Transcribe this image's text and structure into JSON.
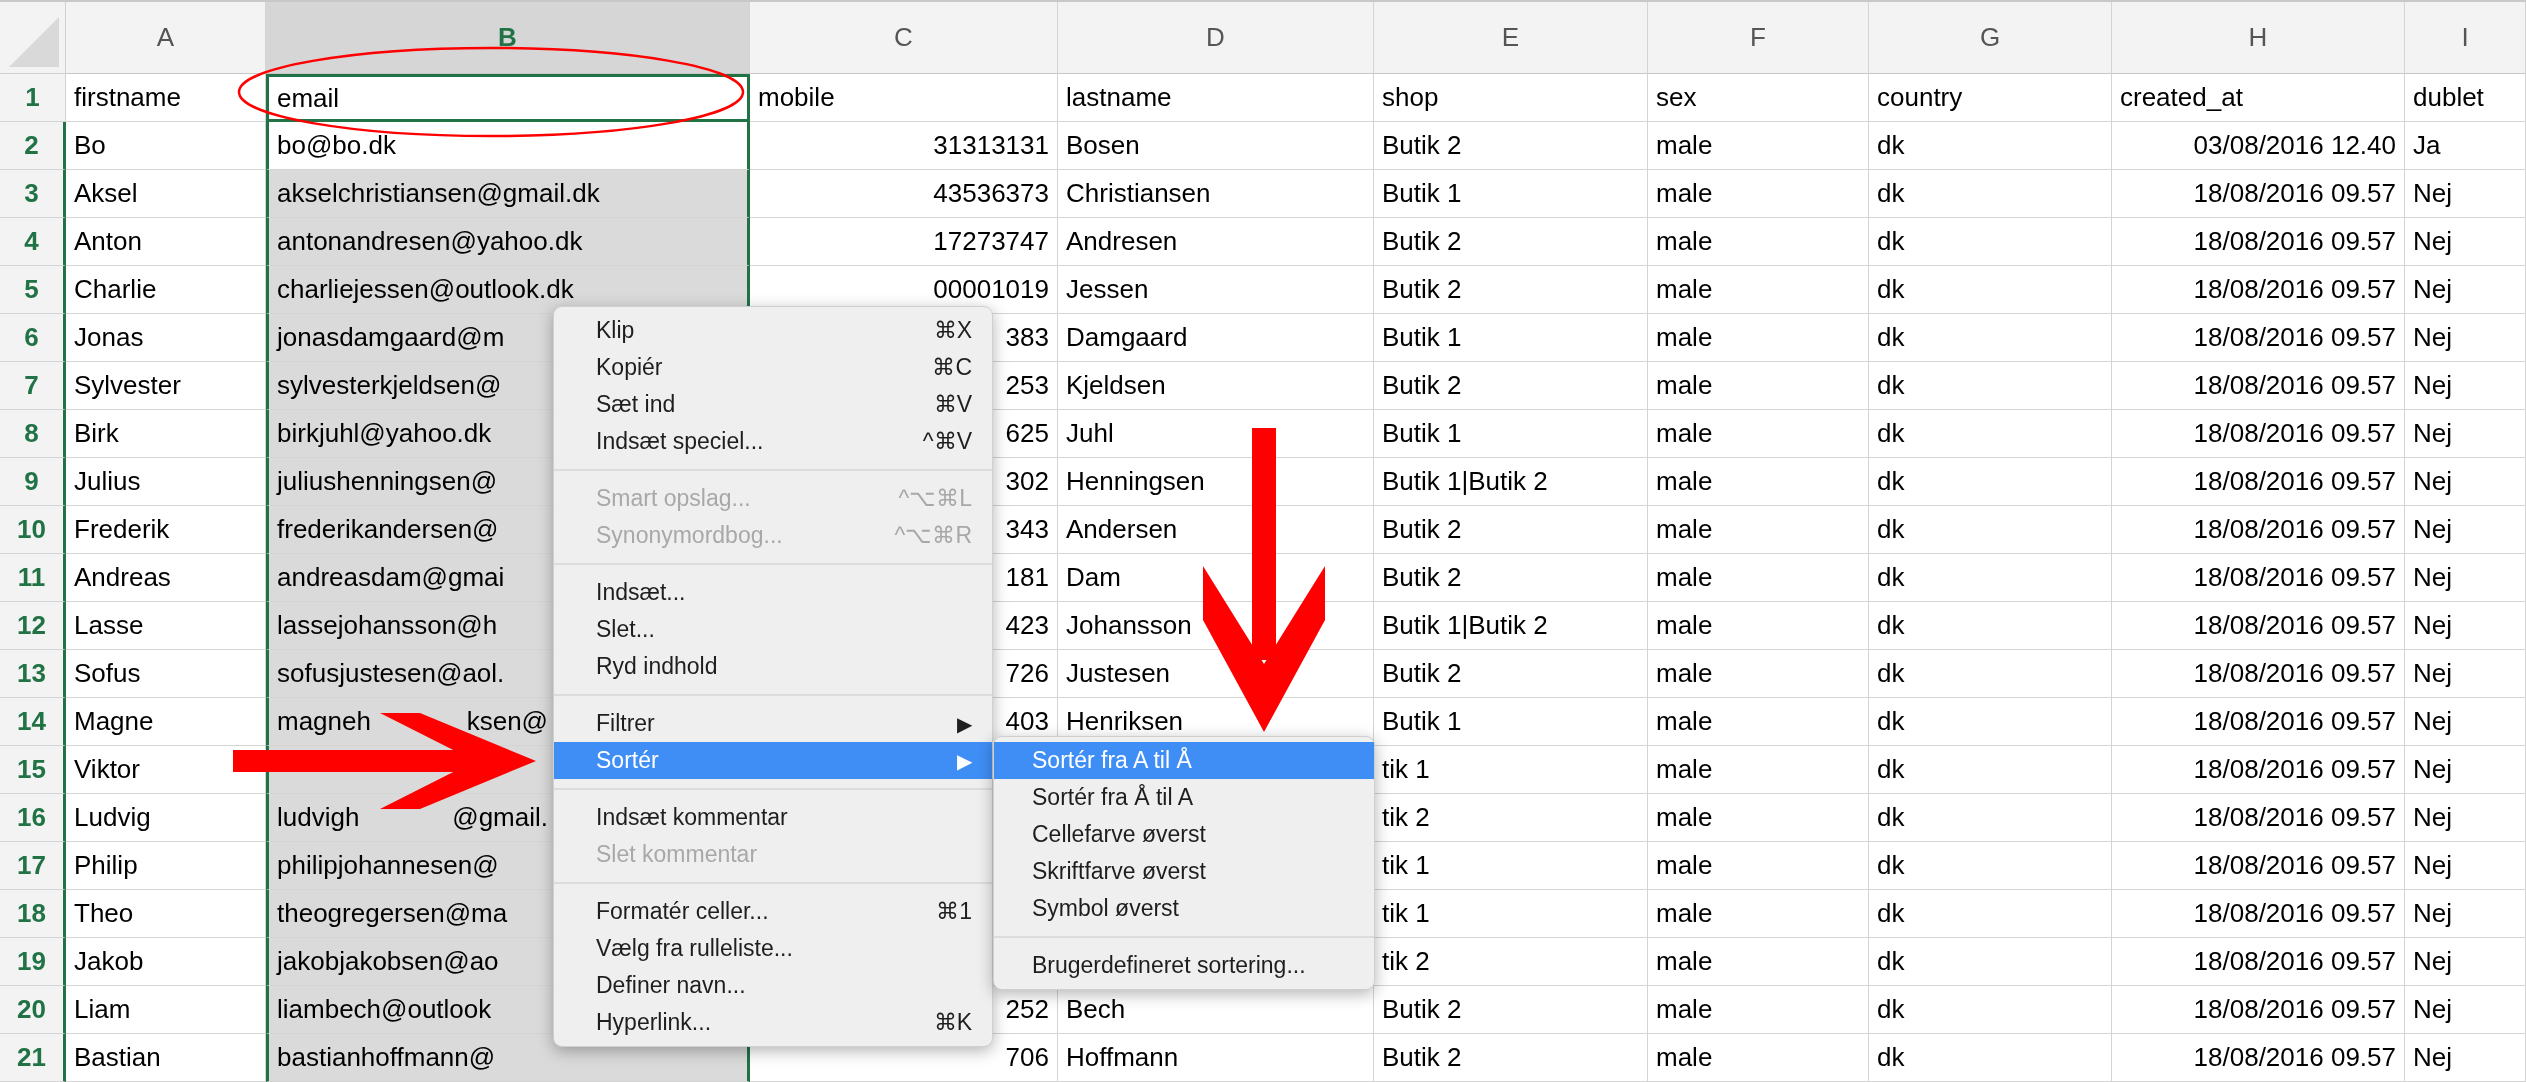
{
  "columns": [
    {
      "label": "A",
      "selected": false,
      "kind": "text"
    },
    {
      "label": "B",
      "selected": true,
      "kind": "text"
    },
    {
      "label": "C",
      "selected": false,
      "kind": "number"
    },
    {
      "label": "D",
      "selected": false,
      "kind": "text"
    },
    {
      "label": "E",
      "selected": false,
      "kind": "text"
    },
    {
      "label": "F",
      "selected": false,
      "kind": "text"
    },
    {
      "label": "G",
      "selected": false,
      "kind": "text"
    },
    {
      "label": "H",
      "selected": false,
      "kind": "number"
    },
    {
      "label": "I",
      "selected": false,
      "kind": "text"
    }
  ],
  "rows": [
    {
      "number": "1",
      "kind": "header",
      "selected": false,
      "cells": [
        "firstname",
        "email",
        "mobile",
        "lastname",
        "shop",
        "sex",
        "country",
        "created_at",
        "dublet"
      ]
    },
    {
      "number": "2",
      "kind": "data",
      "selected": false,
      "cells": [
        "Bo",
        "bo@bo.dk",
        "31313131",
        "Bosen",
        "Butik 2",
        "male",
        "dk",
        "03/08/2016 12.40",
        "Ja"
      ]
    },
    {
      "number": "3",
      "kind": "data",
      "selected": true,
      "cells": [
        "Aksel",
        "akselchristiansen@gmail.dk",
        "43536373",
        "Christiansen",
        "Butik 1",
        "male",
        "dk",
        "18/08/2016 09.57",
        "Nej"
      ]
    },
    {
      "number": "4",
      "kind": "data",
      "selected": true,
      "cells": [
        "Anton",
        "antonandresen@yahoo.dk",
        "17273747",
        "Andresen",
        "Butik 2",
        "male",
        "dk",
        "18/08/2016 09.57",
        "Nej"
      ]
    },
    {
      "number": "5",
      "kind": "data",
      "selected": true,
      "cells": [
        "Charlie",
        "charliejessen@outlook.dk",
        "00001019",
        "Jessen",
        "Butik 2",
        "male",
        "dk",
        "18/08/2016 09.57",
        "Nej"
      ]
    },
    {
      "number": "6",
      "kind": "data",
      "selected": true,
      "cells": [
        "Jonas",
        "jonasdamgaard@m",
        "383",
        "Damgaard",
        "Butik 1",
        "male",
        "dk",
        "18/08/2016 09.57",
        "Nej"
      ]
    },
    {
      "number": "7",
      "kind": "data",
      "selected": true,
      "cells": [
        "Sylvester",
        "sylvesterkjeldsen@",
        "253",
        "Kjeldsen",
        "Butik 2",
        "male",
        "dk",
        "18/08/2016 09.57",
        "Nej"
      ]
    },
    {
      "number": "8",
      "kind": "data",
      "selected": true,
      "cells": [
        "Birk",
        "birkjuhl@yahoo.dk",
        "625",
        "Juhl",
        "Butik 1",
        "male",
        "dk",
        "18/08/2016 09.57",
        "Nej"
      ]
    },
    {
      "number": "9",
      "kind": "data",
      "selected": true,
      "cells": [
        "Julius",
        "juliushenningsen@",
        "302",
        "Henningsen",
        "Butik 1|Butik 2",
        "male",
        "dk",
        "18/08/2016 09.57",
        "Nej"
      ]
    },
    {
      "number": "10",
      "kind": "data",
      "selected": true,
      "cells": [
        "Frederik",
        "frederikandersen@",
        "343",
        "Andersen",
        "Butik 2",
        "male",
        "dk",
        "18/08/2016 09.57",
        "Nej"
      ]
    },
    {
      "number": "11",
      "kind": "data",
      "selected": true,
      "cells": [
        "Andreas",
        "andreasdam@gmai",
        "181",
        "Dam",
        "Butik 2",
        "male",
        "dk",
        "18/08/2016 09.57",
        "Nej"
      ]
    },
    {
      "number": "12",
      "kind": "data",
      "selected": true,
      "cells": [
        "Lasse",
        "lassejohansson@h",
        "423",
        "Johansson",
        "Butik 1|Butik 2",
        "male",
        "dk",
        "18/08/2016 09.57",
        "Nej"
      ]
    },
    {
      "number": "13",
      "kind": "data",
      "selected": true,
      "cells": [
        "Sofus",
        "sofusjustesen@aol.",
        "726",
        "Justesen",
        "Butik 2",
        "male",
        "dk",
        "18/08/2016 09.57",
        "Nej"
      ]
    },
    {
      "number": "14",
      "kind": "data",
      "selected": true,
      "cells": [
        "Magne",
        [
          "magneh",
          "ksen@"
        ],
        "403",
        "Henriksen",
        "Butik 1",
        "male",
        "dk",
        "18/08/2016 09.57",
        "Nej"
      ]
    },
    {
      "number": "15",
      "kind": "data",
      "selected": true,
      "cells": [
        "Viktor",
        null,
        null,
        null,
        "tik 1",
        "male",
        "dk",
        "18/08/2016 09.57",
        "Nej"
      ]
    },
    {
      "number": "16",
      "kind": "data",
      "selected": true,
      "cells": [
        "Ludvig",
        [
          "ludvigh",
          "@gmail."
        ],
        null,
        null,
        "tik 2",
        "male",
        "dk",
        "18/08/2016 09.57",
        "Nej"
      ]
    },
    {
      "number": "17",
      "kind": "data",
      "selected": true,
      "cells": [
        "Philip",
        "philipjohannesen@",
        null,
        null,
        "tik 1",
        "male",
        "dk",
        "18/08/2016 09.57",
        "Nej"
      ]
    },
    {
      "number": "18",
      "kind": "data",
      "selected": true,
      "cells": [
        "Theo",
        "theogregersen@ma",
        null,
        null,
        "tik 1",
        "male",
        "dk",
        "18/08/2016 09.57",
        "Nej"
      ]
    },
    {
      "number": "19",
      "kind": "data",
      "selected": true,
      "cells": [
        "Jakob",
        "jakobjakobsen@ao",
        null,
        null,
        "tik 2",
        "male",
        "dk",
        "18/08/2016 09.57",
        "Nej"
      ]
    },
    {
      "number": "20",
      "kind": "data",
      "selected": true,
      "cells": [
        "Liam",
        "liambech@outlook",
        "252",
        "Bech",
        "Butik 2",
        "male",
        "dk",
        "18/08/2016 09.57",
        "Nej"
      ]
    },
    {
      "number": "21",
      "kind": "data",
      "selected": true,
      "cells": [
        "Bastian",
        "bastianhoffmann@",
        "706",
        "Hoffmann",
        "Butik 2",
        "male",
        "dk",
        "18/08/2016 09.57",
        "Nej"
      ]
    }
  ],
  "context_menu": {
    "sections": [
      [
        {
          "label": "Klip",
          "shortcut": "⌘X",
          "disabled": false,
          "selected": false
        },
        {
          "label": "Kopiér",
          "shortcut": "⌘C",
          "disabled": false,
          "selected": false
        },
        {
          "label": "Sæt ind",
          "shortcut": "⌘V",
          "disabled": false,
          "selected": false
        },
        {
          "label": "Indsæt speciel...",
          "shortcut": "^⌘V",
          "disabled": false,
          "selected": false
        }
      ],
      [
        {
          "label": "Smart opslag...",
          "shortcut": "^⌥⌘L",
          "disabled": true,
          "selected": false
        },
        {
          "label": "Synonymordbog...",
          "shortcut": "^⌥⌘R",
          "disabled": true,
          "selected": false
        }
      ],
      [
        {
          "label": "Indsæt...",
          "disabled": false,
          "selected": false
        },
        {
          "label": "Slet...",
          "disabled": false,
          "selected": false
        },
        {
          "label": "Ryd indhold",
          "disabled": false,
          "selected": false
        }
      ],
      [
        {
          "label": "Filtrer",
          "submenu_arrow": "▶",
          "disabled": false,
          "selected": false
        },
        {
          "label": "Sortér",
          "submenu_arrow": "▶",
          "disabled": false,
          "selected": true
        }
      ],
      [
        {
          "label": "Indsæt kommentar",
          "disabled": false,
          "selected": false
        },
        {
          "label": "Slet kommentar",
          "disabled": true,
          "selected": false
        }
      ],
      [
        {
          "label": "Formatér celler...",
          "shortcut": "⌘1",
          "disabled": false,
          "selected": false
        },
        {
          "label": "Vælg fra rulleliste...",
          "disabled": false,
          "selected": false
        },
        {
          "label": "Definer navn...",
          "disabled": false,
          "selected": false
        },
        {
          "label": "Hyperlink...",
          "shortcut": "⌘K",
          "disabled": false,
          "selected": false
        }
      ]
    ]
  },
  "submenu": {
    "sections": [
      [
        {
          "label": "Sortér fra A til Å",
          "selected": true
        },
        {
          "label": "Sortér fra Å til A",
          "selected": false
        },
        {
          "label": "Cellefarve øverst",
          "selected": false
        },
        {
          "label": "Skriftfarve øverst",
          "selected": false
        },
        {
          "label": "Symbol øverst",
          "selected": false
        }
      ],
      [
        {
          "label": "Brugerdefineret sortering...",
          "selected": false
        }
      ]
    ]
  }
}
